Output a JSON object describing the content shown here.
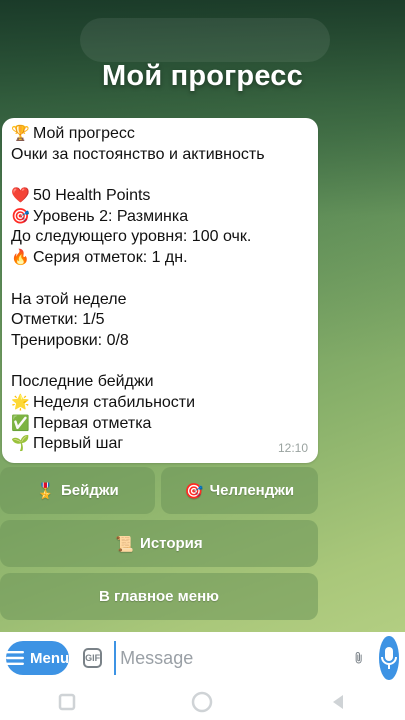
{
  "header": {
    "title": "Мой прогресс"
  },
  "message": {
    "lines": [
      {
        "icon": "🏆",
        "text": "Мой прогресс"
      },
      {
        "icon": "",
        "text": "Очки за постоянство и активность"
      },
      {
        "icon": "",
        "text": ""
      },
      {
        "icon": "❤️",
        "text": "50 Health Points"
      },
      {
        "icon": "🎯",
        "text": "Уровень 2: Разминка"
      },
      {
        "icon": "",
        "text": "До следующего уровня: 100 очк."
      },
      {
        "icon": "🔥",
        "text": "Серия отметок: 1 дн."
      },
      {
        "icon": "",
        "text": ""
      },
      {
        "icon": "",
        "text": "На этой неделе"
      },
      {
        "icon": "",
        "text": "Отметки: 1/5"
      },
      {
        "icon": "",
        "text": "Тренировки: 0/8"
      },
      {
        "icon": "",
        "text": ""
      },
      {
        "icon": "",
        "text": "Последние бейджи"
      },
      {
        "icon": "🌟",
        "text": "Неделя стабильности"
      },
      {
        "icon": "✅",
        "text": "Первая отметка"
      },
      {
        "icon": "🌱",
        "text": "Первый шаг"
      }
    ],
    "time": "12:10"
  },
  "keyboard": {
    "badges": {
      "icon": "🎖️",
      "label": "Бейджи"
    },
    "challenges": {
      "icon": "🎯",
      "label": "Челленджи"
    },
    "history": {
      "icon": "📜",
      "label": "История"
    },
    "main_menu": {
      "label": "В главное меню"
    }
  },
  "input": {
    "menu_label": "Menu",
    "gif_label": "GIF",
    "placeholder": "Message"
  },
  "colors": {
    "accent": "#3d93e4",
    "button_bg": "#6e965a"
  }
}
